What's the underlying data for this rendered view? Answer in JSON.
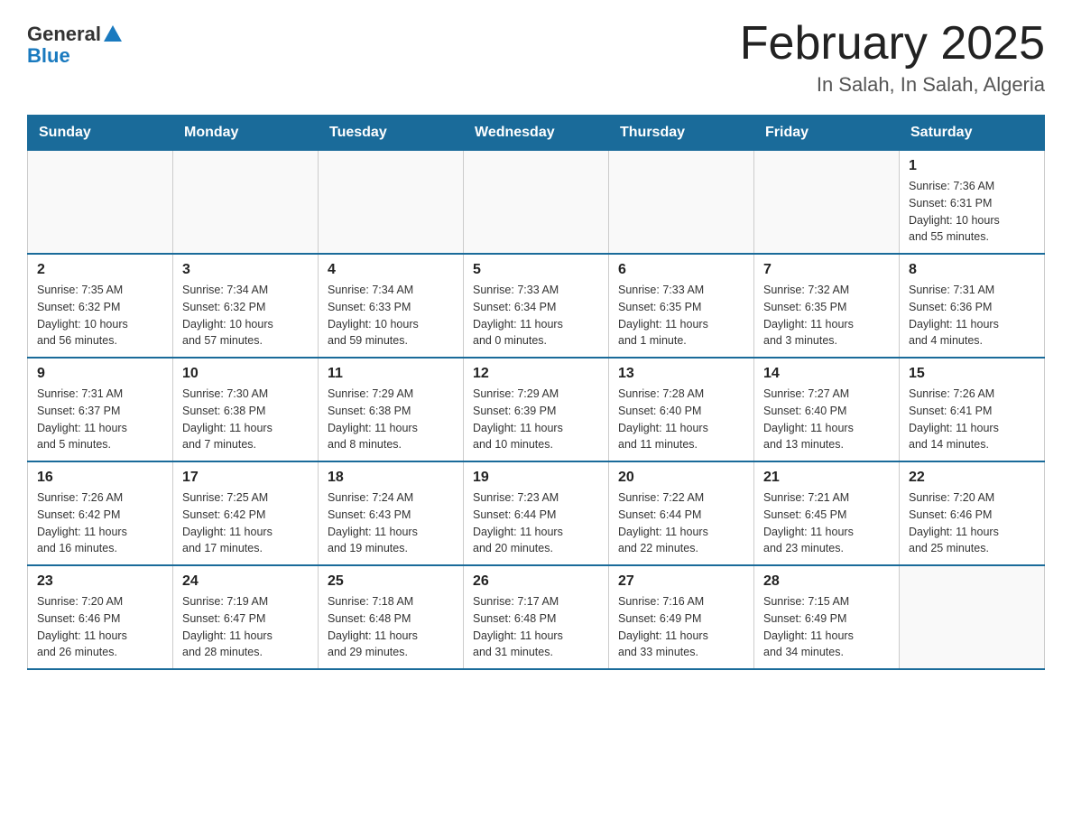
{
  "header": {
    "logo_general": "General",
    "logo_blue": "Blue",
    "title": "February 2025",
    "subtitle": "In Salah, In Salah, Algeria"
  },
  "days_of_week": [
    "Sunday",
    "Monday",
    "Tuesday",
    "Wednesday",
    "Thursday",
    "Friday",
    "Saturday"
  ],
  "weeks": [
    {
      "cells": [
        {
          "day": "",
          "info": ""
        },
        {
          "day": "",
          "info": ""
        },
        {
          "day": "",
          "info": ""
        },
        {
          "day": "",
          "info": ""
        },
        {
          "day": "",
          "info": ""
        },
        {
          "day": "",
          "info": ""
        },
        {
          "day": "1",
          "info": "Sunrise: 7:36 AM\nSunset: 6:31 PM\nDaylight: 10 hours\nand 55 minutes."
        }
      ]
    },
    {
      "cells": [
        {
          "day": "2",
          "info": "Sunrise: 7:35 AM\nSunset: 6:32 PM\nDaylight: 10 hours\nand 56 minutes."
        },
        {
          "day": "3",
          "info": "Sunrise: 7:34 AM\nSunset: 6:32 PM\nDaylight: 10 hours\nand 57 minutes."
        },
        {
          "day": "4",
          "info": "Sunrise: 7:34 AM\nSunset: 6:33 PM\nDaylight: 10 hours\nand 59 minutes."
        },
        {
          "day": "5",
          "info": "Sunrise: 7:33 AM\nSunset: 6:34 PM\nDaylight: 11 hours\nand 0 minutes."
        },
        {
          "day": "6",
          "info": "Sunrise: 7:33 AM\nSunset: 6:35 PM\nDaylight: 11 hours\nand 1 minute."
        },
        {
          "day": "7",
          "info": "Sunrise: 7:32 AM\nSunset: 6:35 PM\nDaylight: 11 hours\nand 3 minutes."
        },
        {
          "day": "8",
          "info": "Sunrise: 7:31 AM\nSunset: 6:36 PM\nDaylight: 11 hours\nand 4 minutes."
        }
      ]
    },
    {
      "cells": [
        {
          "day": "9",
          "info": "Sunrise: 7:31 AM\nSunset: 6:37 PM\nDaylight: 11 hours\nand 5 minutes."
        },
        {
          "day": "10",
          "info": "Sunrise: 7:30 AM\nSunset: 6:38 PM\nDaylight: 11 hours\nand 7 minutes."
        },
        {
          "day": "11",
          "info": "Sunrise: 7:29 AM\nSunset: 6:38 PM\nDaylight: 11 hours\nand 8 minutes."
        },
        {
          "day": "12",
          "info": "Sunrise: 7:29 AM\nSunset: 6:39 PM\nDaylight: 11 hours\nand 10 minutes."
        },
        {
          "day": "13",
          "info": "Sunrise: 7:28 AM\nSunset: 6:40 PM\nDaylight: 11 hours\nand 11 minutes."
        },
        {
          "day": "14",
          "info": "Sunrise: 7:27 AM\nSunset: 6:40 PM\nDaylight: 11 hours\nand 13 minutes."
        },
        {
          "day": "15",
          "info": "Sunrise: 7:26 AM\nSunset: 6:41 PM\nDaylight: 11 hours\nand 14 minutes."
        }
      ]
    },
    {
      "cells": [
        {
          "day": "16",
          "info": "Sunrise: 7:26 AM\nSunset: 6:42 PM\nDaylight: 11 hours\nand 16 minutes."
        },
        {
          "day": "17",
          "info": "Sunrise: 7:25 AM\nSunset: 6:42 PM\nDaylight: 11 hours\nand 17 minutes."
        },
        {
          "day": "18",
          "info": "Sunrise: 7:24 AM\nSunset: 6:43 PM\nDaylight: 11 hours\nand 19 minutes."
        },
        {
          "day": "19",
          "info": "Sunrise: 7:23 AM\nSunset: 6:44 PM\nDaylight: 11 hours\nand 20 minutes."
        },
        {
          "day": "20",
          "info": "Sunrise: 7:22 AM\nSunset: 6:44 PM\nDaylight: 11 hours\nand 22 minutes."
        },
        {
          "day": "21",
          "info": "Sunrise: 7:21 AM\nSunset: 6:45 PM\nDaylight: 11 hours\nand 23 minutes."
        },
        {
          "day": "22",
          "info": "Sunrise: 7:20 AM\nSunset: 6:46 PM\nDaylight: 11 hours\nand 25 minutes."
        }
      ]
    },
    {
      "cells": [
        {
          "day": "23",
          "info": "Sunrise: 7:20 AM\nSunset: 6:46 PM\nDaylight: 11 hours\nand 26 minutes."
        },
        {
          "day": "24",
          "info": "Sunrise: 7:19 AM\nSunset: 6:47 PM\nDaylight: 11 hours\nand 28 minutes."
        },
        {
          "day": "25",
          "info": "Sunrise: 7:18 AM\nSunset: 6:48 PM\nDaylight: 11 hours\nand 29 minutes."
        },
        {
          "day": "26",
          "info": "Sunrise: 7:17 AM\nSunset: 6:48 PM\nDaylight: 11 hours\nand 31 minutes."
        },
        {
          "day": "27",
          "info": "Sunrise: 7:16 AM\nSunset: 6:49 PM\nDaylight: 11 hours\nand 33 minutes."
        },
        {
          "day": "28",
          "info": "Sunrise: 7:15 AM\nSunset: 6:49 PM\nDaylight: 11 hours\nand 34 minutes."
        },
        {
          "day": "",
          "info": ""
        }
      ]
    }
  ]
}
